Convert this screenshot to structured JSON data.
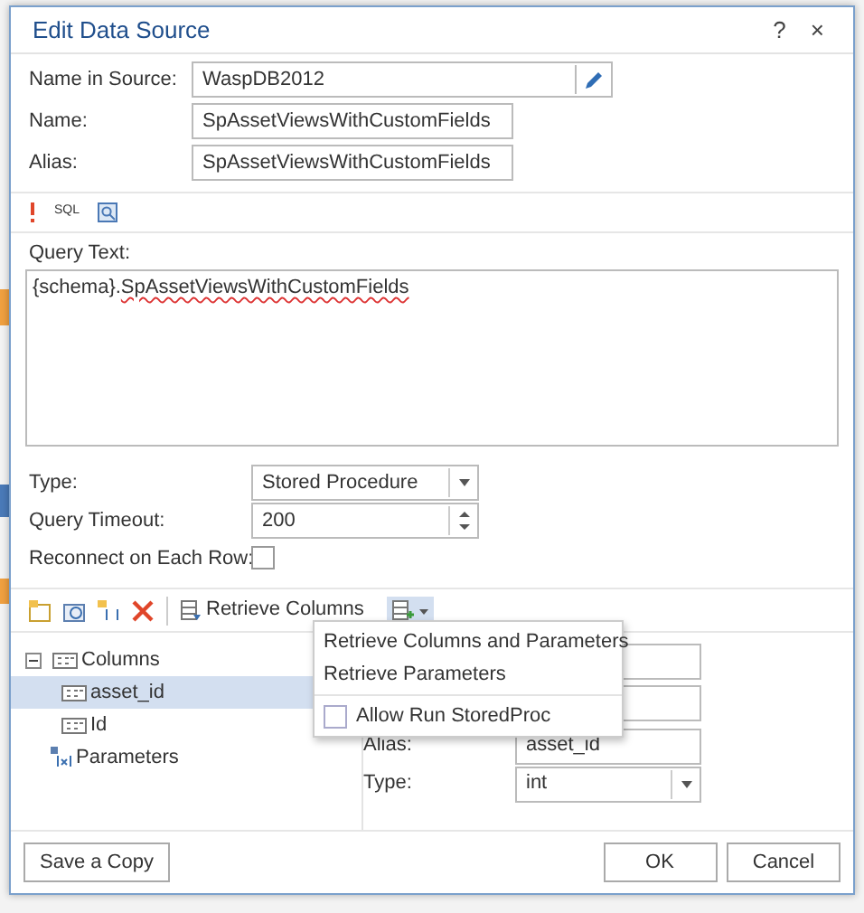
{
  "window": {
    "title": "Edit Data Source",
    "help": "?",
    "close": "×"
  },
  "fields": [
    {
      "label": "Name in Source:",
      "value": "WaspDB2012",
      "kind": "edit"
    },
    {
      "label": "Name:",
      "value": "SpAssetViewsWithCustomFields",
      "kind": "text"
    },
    {
      "label": "Alias:",
      "value": "SpAssetViewsWithCustomFields",
      "kind": "text"
    }
  ],
  "query_toolbar": {
    "sql_label": "SQL"
  },
  "query": {
    "label": "Query Text:",
    "value": "{schema}.SpAssetViewsWithCustomFields"
  },
  "options": [
    {
      "label": "Type:",
      "value": "Stored Procedure",
      "kind": "select"
    },
    {
      "label": "Query Timeout:",
      "value": "200",
      "kind": "spin"
    },
    {
      "label": "Reconnect on Each Row:",
      "kind": "checkbox",
      "checked": false
    }
  ],
  "columns_toolbar": {
    "retrieve_label": "Retrieve Columns"
  },
  "tree": [
    {
      "label": "Columns",
      "expanded": true,
      "selected": false,
      "children": [
        {
          "label": "asset_id",
          "selected": true
        },
        {
          "label": "Id",
          "selected": false
        }
      ]
    },
    {
      "label": "Parameters",
      "selected": false
    }
  ],
  "properties": [
    {
      "label": "Alias:",
      "value": "asset_id",
      "kind": "text"
    },
    {
      "label": "Type:",
      "value": "int",
      "kind": "select"
    }
  ],
  "menu": [
    {
      "label": "Retrieve Columns and Parameters",
      "kind": "item"
    },
    {
      "label": "Retrieve Parameters",
      "kind": "item"
    },
    {
      "label": "Allow Run StoredProc",
      "kind": "checkbox",
      "checked": false
    }
  ],
  "footer": {
    "left_button": "Save a Copy",
    "buttons": [
      "OK",
      "Cancel"
    ]
  }
}
